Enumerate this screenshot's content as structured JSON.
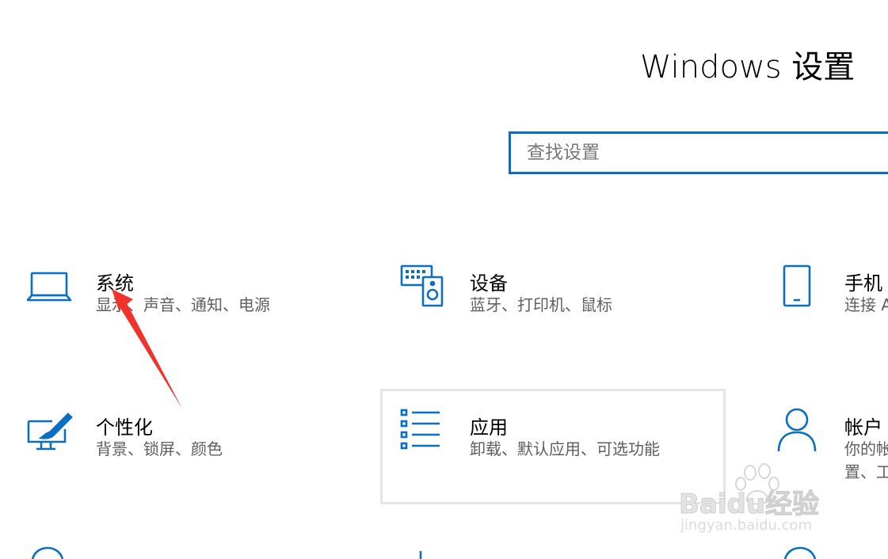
{
  "header": {
    "title": "Windows 设置"
  },
  "search": {
    "placeholder": "查找设置"
  },
  "tiles": [
    {
      "name": "系统",
      "desc": "显示、声音、通知、电源",
      "icon": "laptop-icon"
    },
    {
      "name": "设备",
      "desc": "蓝牙、打印机、鼠标",
      "icon": "keyboard-speaker-icon"
    },
    {
      "name": "手机",
      "desc": "连接 A",
      "icon": "phone-icon"
    },
    {
      "name": "个性化",
      "desc": "背景、锁屏、颜色",
      "icon": "paint-brush-icon"
    },
    {
      "name": "应用",
      "desc": "卸载、默认应用、可选功能",
      "icon": "apps-list-icon"
    },
    {
      "name": "帐户",
      "desc1": "你的帐",
      "desc2": "置、工",
      "icon": "person-icon"
    }
  ],
  "watermark": {
    "brand": "Baidu经验",
    "url": "jingyan.baidu.com"
  },
  "colors": {
    "accent": "#0a6fc2",
    "arrow": "#f0322a",
    "text": "#000000",
    "subtext": "#5f5f5f"
  }
}
